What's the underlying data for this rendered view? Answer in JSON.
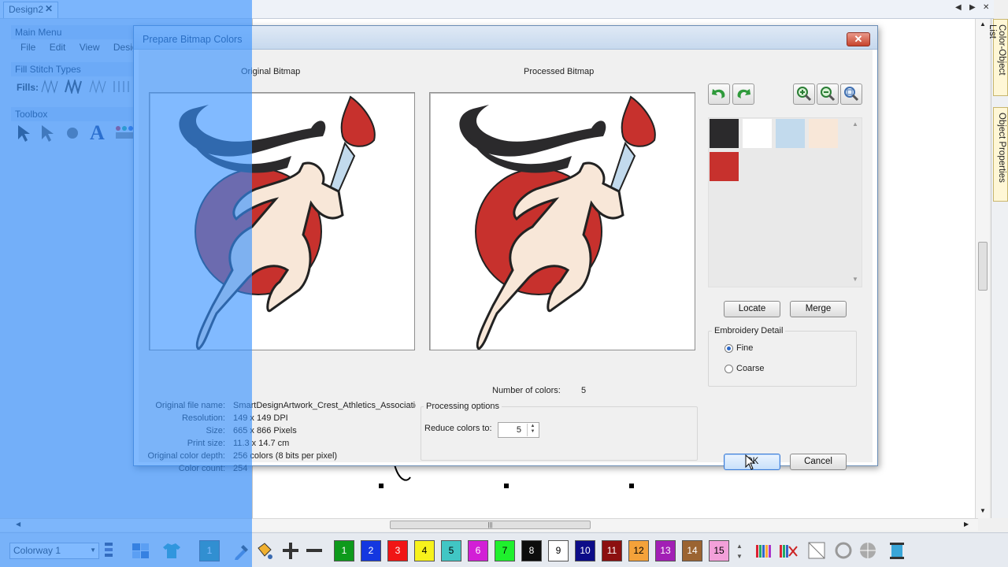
{
  "window": {
    "tab_title": "Design2",
    "tab_close": "✕"
  },
  "left_panel": {
    "main_menu_title": "Main Menu",
    "menu_items": [
      "File",
      "Edit",
      "View",
      "Desig"
    ],
    "fill_stitch_title": "Fill Stitch Types",
    "fills_label": "Fills:",
    "toolbox_title": "Toolbox"
  },
  "right_dock": {
    "tab1": "Color-Object List",
    "tab2": "Object Properties"
  },
  "dialog": {
    "title": "Prepare Bitmap Colors",
    "close": "✕",
    "original_caption": "Original Bitmap",
    "processed_caption": "Processed Bitmap",
    "info": [
      {
        "label": "Original file name:",
        "value": "SmartDesignArtwork_Crest_Athletics_Associatio"
      },
      {
        "label": "Resolution:",
        "value": "149 x 149 DPI"
      },
      {
        "label": "Size:",
        "value": "665 x 866 Pixels"
      },
      {
        "label": "Print size:",
        "value": "11.3 x 14.7 cm"
      },
      {
        "label": "Original color depth:",
        "value": "256 colors (8 bits per pixel)"
      },
      {
        "label": "Color count:",
        "value": "254"
      }
    ],
    "num_colors_label": "Number of colors:",
    "num_colors_value": "5",
    "processing_options_title": "Processing options",
    "reduce_colors_label": "Reduce colors to:",
    "reduce_colors_value": "5",
    "swatches": [
      "#2b2a2c",
      "#ffffff",
      "#c2daed",
      "#f8e7d8",
      "#c7312d"
    ],
    "locate_button": "Locate",
    "merge_button": "Merge",
    "embroidery_detail_title": "Embroidery Detail",
    "fine_label": "Fine",
    "coarse_label": "Coarse",
    "selected_detail": "Fine",
    "ok_button": "OK",
    "cancel_button": "Cancel"
  },
  "bottom_bar": {
    "colorway": "Colorway 1",
    "active_color": "1",
    "colors": [
      {
        "label": "1",
        "color": "#0e9a1c",
        "text": "#ffffff"
      },
      {
        "label": "2",
        "color": "#1437e0",
        "text": "#ffffff"
      },
      {
        "label": "3",
        "color": "#f01515",
        "text": "#ffffff"
      },
      {
        "label": "4",
        "color": "#f7f21c",
        "text": "#000000"
      },
      {
        "label": "5",
        "color": "#41c6c4",
        "text": "#000000"
      },
      {
        "label": "6",
        "color": "#d21fd6",
        "text": "#ffffff"
      },
      {
        "label": "7",
        "color": "#1ff02d",
        "text": "#000000"
      },
      {
        "label": "8",
        "color": "#0c0c0c",
        "text": "#ffffff"
      },
      {
        "label": "9",
        "color": "#ffffff",
        "text": "#000000"
      },
      {
        "label": "10",
        "color": "#0c0c88",
        "text": "#ffffff"
      },
      {
        "label": "11",
        "color": "#8c1010",
        "text": "#ffffff"
      },
      {
        "label": "12",
        "color": "#f4a23a",
        "text": "#000000"
      },
      {
        "label": "13",
        "color": "#a21fb5",
        "text": "#ffffff"
      },
      {
        "label": "14",
        "color": "#9b6432",
        "text": "#ffffff"
      },
      {
        "label": "15",
        "color": "#f3a0d9",
        "text": "#000000"
      }
    ]
  }
}
